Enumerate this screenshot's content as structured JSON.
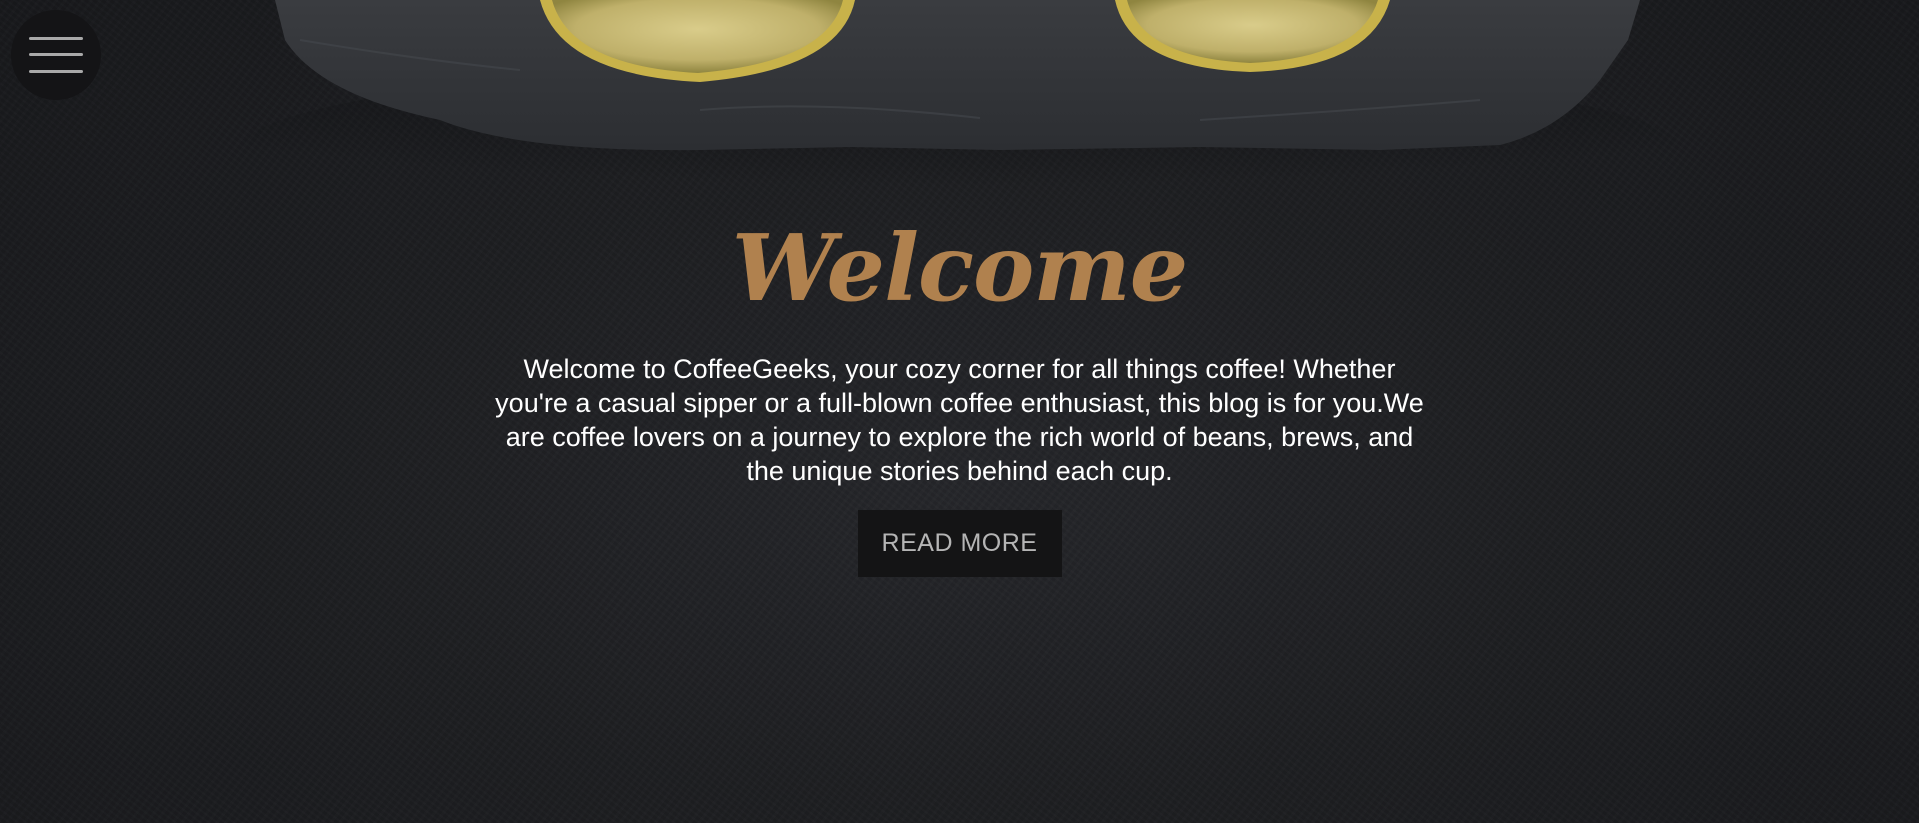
{
  "colors": {
    "background": "#1c1d20",
    "accent": "#b0814e",
    "button_bg": "#141415",
    "button_text": "#b5b5b5",
    "text": "#ffffff"
  },
  "header": {
    "menu_icon": "hamburger-menu-icon"
  },
  "hero_image": {
    "subject": "lemon-halves-on-slate-board"
  },
  "welcome": {
    "title": "Welcome",
    "text": "Welcome to CoffeeGeeks, your cozy corner for all things coffee! Whether you're a casual sipper or a full-blown coffee enthusiast, this blog is for you.We are coffee lovers on a journey to explore the rich world of beans, brews, and the unique stories behind each cup.",
    "button_label": "READ MORE"
  }
}
